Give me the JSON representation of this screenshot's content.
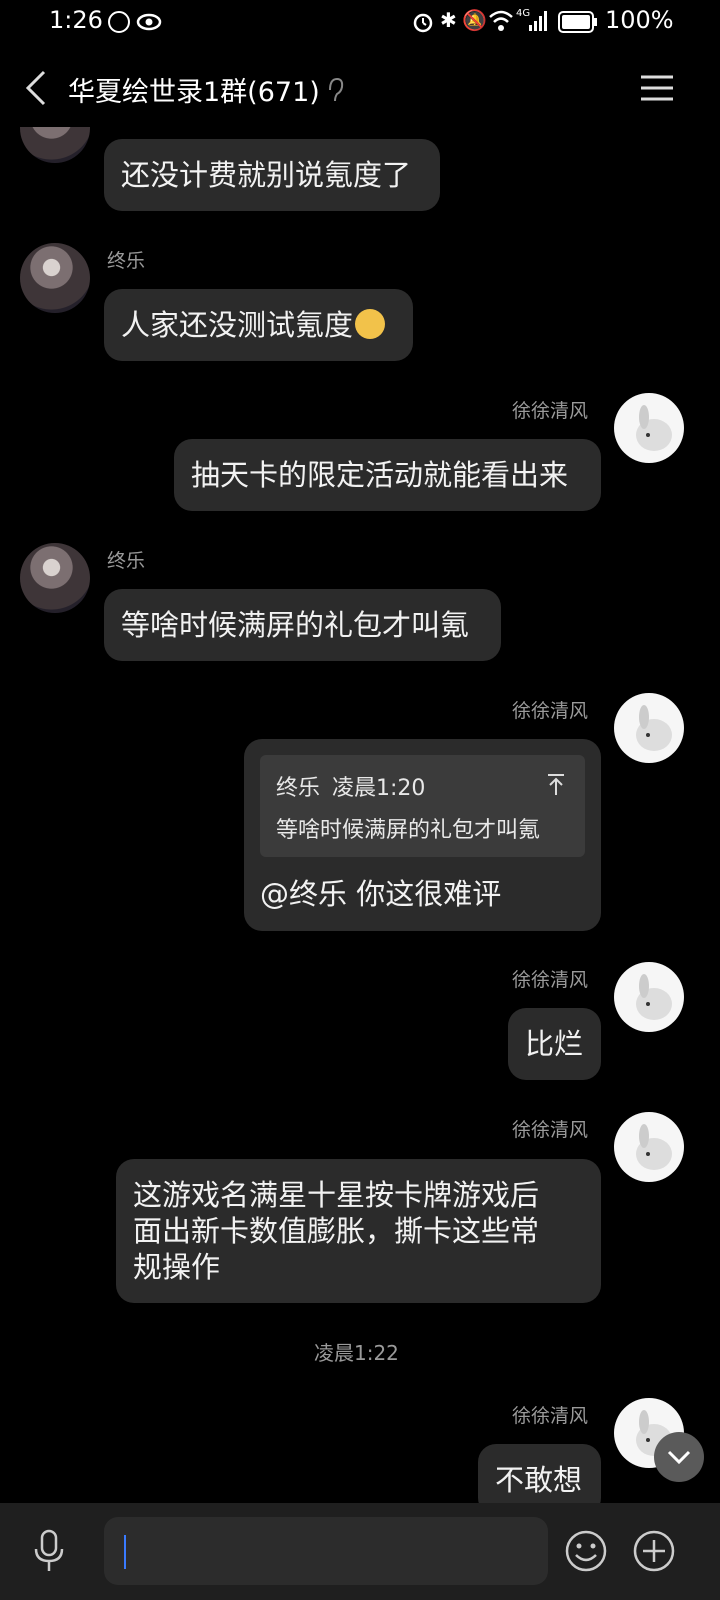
{
  "status_bar": {
    "time": "1:26",
    "network": "4G",
    "battery": "100%"
  },
  "header": {
    "title": "华夏绘世录1群(671)"
  },
  "messages": [
    {
      "text": "还没计费就别说氪度了"
    },
    {
      "sender": "终乐",
      "text": "人家还没测试氪度"
    },
    {
      "sender": "徐徐清风",
      "text": "抽天卡的限定活动就能看出来"
    },
    {
      "sender": "终乐",
      "text": "等啥时候满屏的礼包才叫氪"
    },
    {
      "sender": "徐徐清风",
      "quote": {
        "author": "终乐",
        "time": "凌晨1:20",
        "text": "等啥时候满屏的礼包才叫氪"
      },
      "text": "@终乐 你这很难评"
    },
    {
      "sender": "徐徐清风",
      "text": "比烂"
    },
    {
      "sender": "徐徐清风",
      "lines": [
        "这游戏名满星十星按卡牌游戏后",
        "面出新卡数值膨胀，撕卡这些常",
        "规操作"
      ]
    },
    {
      "sender": "徐徐清风",
      "text": "不敢想"
    }
  ],
  "timestamp": "凌晨1:22"
}
